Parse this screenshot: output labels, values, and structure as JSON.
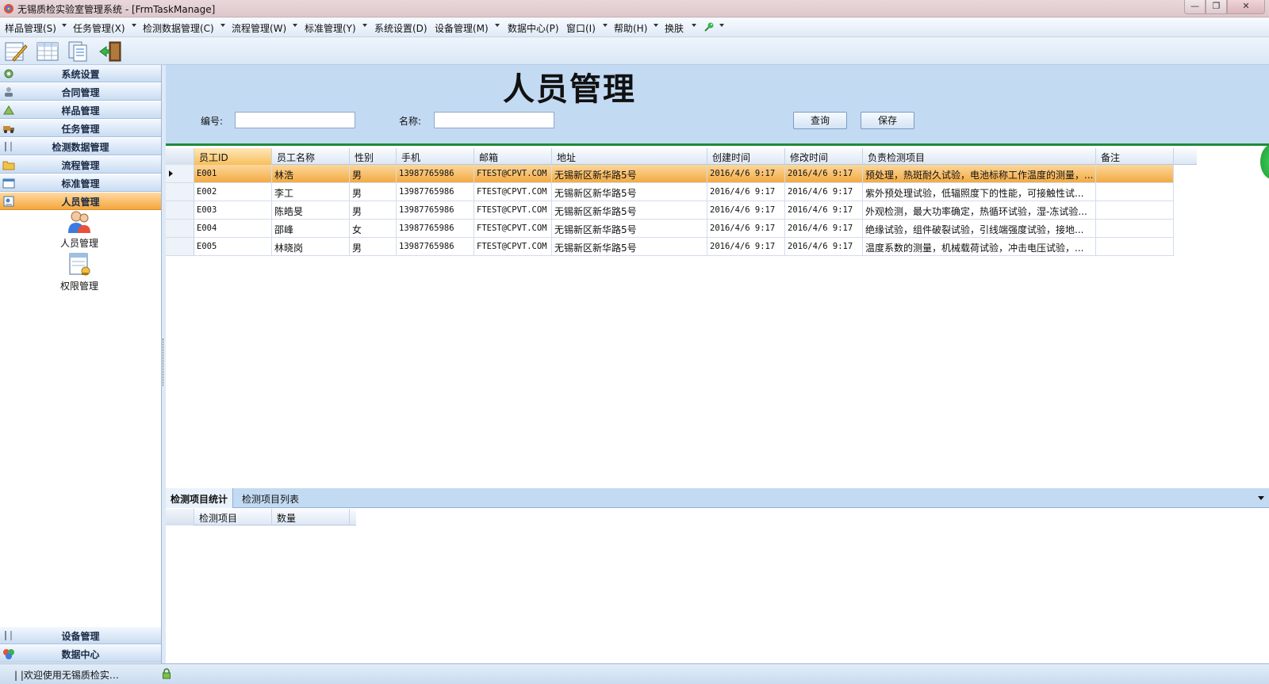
{
  "window": {
    "title": "无锡质检实验室管理系统 - [FrmTaskManage]",
    "min_glyph": "—",
    "max_glyph": "❐",
    "close_glyph": "✕"
  },
  "menu": {
    "items": [
      {
        "label": "样品管理(S)"
      },
      {
        "label": "任务管理(X)"
      },
      {
        "label": "检测数据管理(C)"
      },
      {
        "label": "流程管理(W)"
      },
      {
        "label": "标准管理(Y)"
      },
      {
        "label": "系统设置(D)"
      },
      {
        "label": "设备管理(M)"
      },
      {
        "label": "数据中心(P)"
      },
      {
        "label": "窗口(I)"
      },
      {
        "label": "帮助(H)"
      },
      {
        "label": "换肤"
      }
    ]
  },
  "toolbar": {
    "icons": [
      "edit-sheet-icon",
      "table-icon",
      "copy-docs-icon",
      "exit-door-icon"
    ]
  },
  "nav": {
    "top": [
      {
        "label": "系统设置"
      },
      {
        "label": "合同管理"
      },
      {
        "label": "样品管理"
      },
      {
        "label": "任务管理"
      },
      {
        "label": "检测数据管理"
      },
      {
        "label": "流程管理"
      },
      {
        "label": "标准管理"
      },
      {
        "label": "人员管理"
      }
    ],
    "sub_items": [
      {
        "label": "人员管理"
      },
      {
        "label": "权限管理"
      }
    ],
    "bottom": [
      {
        "label": "设备管理"
      },
      {
        "label": "数据中心"
      }
    ]
  },
  "page": {
    "title": "人员管理",
    "id_label": "编号:",
    "id_value": "",
    "name_label": "名称:",
    "name_value": "",
    "query_btn": "查询",
    "save_btn": "保存"
  },
  "grid": {
    "columns": [
      "员工ID",
      "员工名称",
      "性别",
      "手机",
      "邮箱",
      "地址",
      "创建时间",
      "修改时间",
      "负责检测项目",
      "备注"
    ],
    "rows": [
      {
        "id": "E001",
        "name": "林浩",
        "sex": "男",
        "phone": "13987765986",
        "email": "FTEST@CPVT.COM",
        "address": "无锡新区新华路5号",
        "created": "2016/4/6 9:17",
        "modified": "2016/4/6 9:17",
        "projects": "预处理，热斑耐久试验，电池标称工作温度的测量，...",
        "note": ""
      },
      {
        "id": "E002",
        "name": "李工",
        "sex": "男",
        "phone": "13987765986",
        "email": "FTEST@CPVT.COM",
        "address": "无锡新区新华路5号",
        "created": "2016/4/6 9:17",
        "modified": "2016/4/6 9:17",
        "projects": "紫外预处理试验，低辐照度下的性能，可接触性试...",
        "note": ""
      },
      {
        "id": "E003",
        "name": "陈皓旻",
        "sex": "男",
        "phone": "13987765986",
        "email": "FTEST@CPVT.COM",
        "address": "无锡新区新华路5号",
        "created": "2016/4/6 9:17",
        "modified": "2016/4/6 9:17",
        "projects": "外观检测，最大功率确定，热循环试验，湿-冻试验...",
        "note": ""
      },
      {
        "id": "E004",
        "name": "邵峰",
        "sex": "女",
        "phone": "13987765986",
        "email": "FTEST@CPVT.COM",
        "address": "无锡新区新华路5号",
        "created": "2016/4/6 9:17",
        "modified": "2016/4/6 9:17",
        "projects": "绝缘试验，组件破裂试验，引线端强度试验，接地...",
        "note": ""
      },
      {
        "id": "E005",
        "name": "林晓岗",
        "sex": "男",
        "phone": "13987765986",
        "email": "FTEST@CPVT.COM",
        "address": "无锡新区新华路5号",
        "created": "2016/4/6 9:17",
        "modified": "2016/4/6 9:17",
        "projects": "温度系数的测量，机械载荷试验，冲击电压试验，...",
        "note": ""
      }
    ]
  },
  "tabs": [
    {
      "label": "检测项目统计"
    },
    {
      "label": "检测项目列表"
    }
  ],
  "subgrid": {
    "columns": [
      "检测项目",
      "数量"
    ]
  },
  "status": {
    "text": "| |欢迎使用无锡质检实…"
  },
  "colors": {
    "accent_selected": "#f3aa44",
    "header_bg": "#c3daf3",
    "divider_green": "#1f8a3a"
  }
}
